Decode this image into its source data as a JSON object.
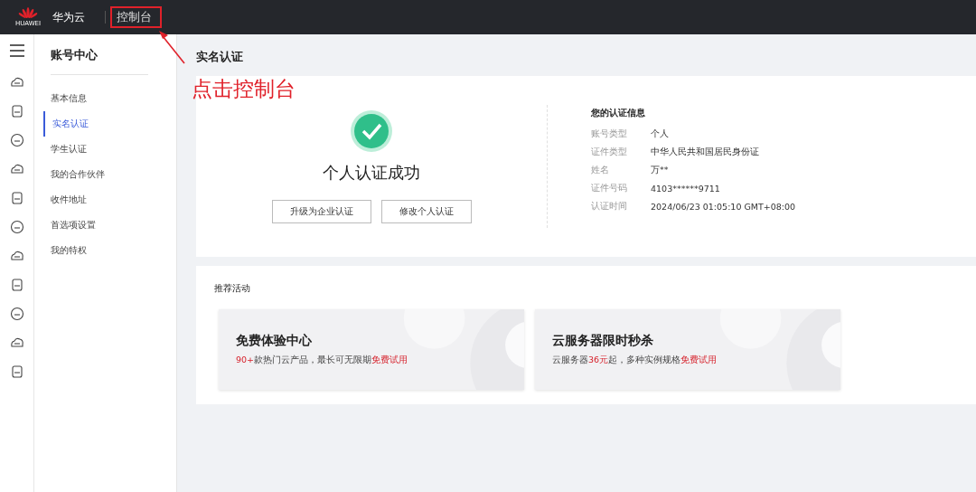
{
  "topbar": {
    "logo_text": "HUAWEI",
    "brand": "华为云",
    "console_link": "控制台"
  },
  "annotation": {
    "text": "点击控制台"
  },
  "sidebar": {
    "title": "账号中心",
    "items": [
      {
        "label": "基本信息",
        "selected": false
      },
      {
        "label": "实名认证",
        "selected": true
      },
      {
        "label": "学生认证",
        "selected": false
      },
      {
        "label": "我的合作伙伴",
        "selected": false
      },
      {
        "label": "收件地址",
        "selected": false
      },
      {
        "label": "首选项设置",
        "selected": false
      },
      {
        "label": "我的特权",
        "selected": false
      }
    ]
  },
  "page_title": "实名认证",
  "verification": {
    "status": "个人认证成功",
    "buttons": [
      "升级为企业认证",
      "修改个人认证"
    ],
    "info_title": "您的认证信息",
    "fields": [
      {
        "label": "账号类型",
        "value": "个人"
      },
      {
        "label": "证件类型",
        "value": "中华人民共和国居民身份证"
      },
      {
        "label": "姓名",
        "value": "万**"
      },
      {
        "label": "证件号码",
        "value": "4103******9711"
      },
      {
        "label": "认证时间",
        "value": "2024/06/23 01:05:10 GMT+08:00"
      }
    ]
  },
  "activities": {
    "title": "推荐活动",
    "cards": [
      {
        "title": "免费体验中心",
        "desc": [
          {
            "text": "90+",
            "highlight": true
          },
          {
            "text": "款热门云产品，最长可无限期",
            "highlight": false
          },
          {
            "text": "免费试用",
            "highlight": true
          }
        ]
      },
      {
        "title": "云服务器限时秒杀",
        "desc": [
          {
            "text": "云服务器",
            "highlight": false
          },
          {
            "text": "36元",
            "highlight": true
          },
          {
            "text": "起，多种实例规格",
            "highlight": false
          },
          {
            "text": "免费试用",
            "highlight": true
          }
        ]
      }
    ]
  }
}
